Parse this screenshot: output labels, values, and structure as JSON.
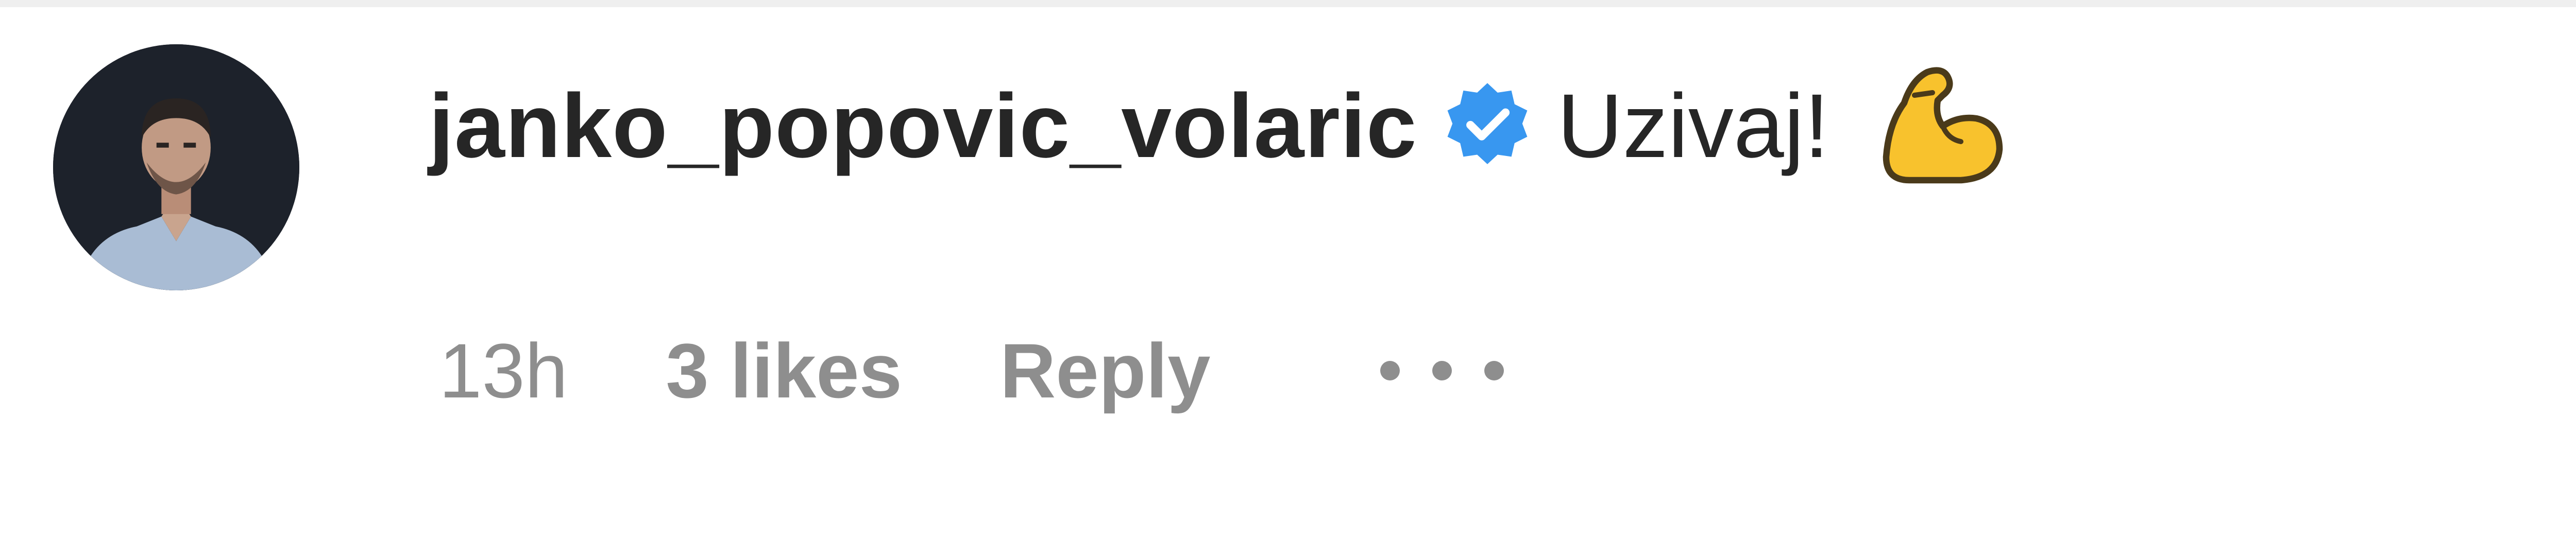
{
  "comment": {
    "username": "janko_popovic_volaric",
    "verified_icon": "verified-badge-icon",
    "text": "Uzivaj!",
    "emoji": "flexed-biceps-emoji",
    "time": "13h",
    "likes": "3 likes",
    "reply_label": "Reply",
    "more_icon": "more-options-icon"
  },
  "colors": {
    "username": "#262626",
    "meta": "#8e8e8e",
    "verified_badge": "#3897f0",
    "emoji_fill": "#f8c22d"
  }
}
